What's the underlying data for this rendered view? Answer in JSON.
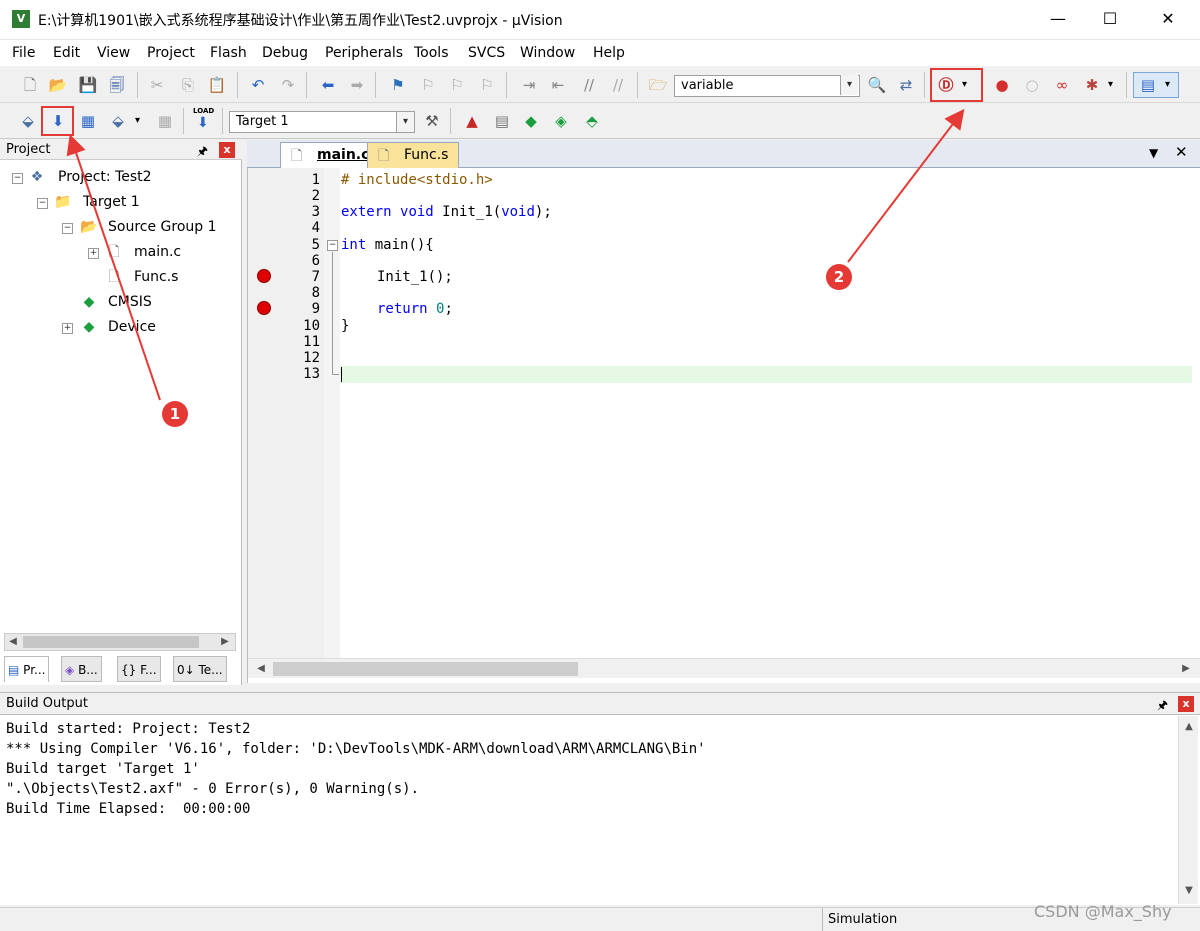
{
  "window": {
    "title": "E:\\计算机1901\\嵌入式系统程序基础设计\\作业\\第五周作业\\Test2.uvprojx - µVision",
    "minimize": "—",
    "maximize": "☐",
    "close": "✕"
  },
  "menu": [
    "File",
    "Edit",
    "View",
    "Project",
    "Flash",
    "Debug",
    "Peripherals",
    "Tools",
    "SVCS",
    "Window",
    "Help"
  ],
  "toolbar1": {
    "find_combo_value": "variable"
  },
  "toolbar2": {
    "target_combo_value": "Target 1",
    "load_label": "LOAD"
  },
  "project_panel": {
    "title": "Project",
    "pin": "🖈",
    "close": "x",
    "tree": {
      "project": "Project: Test2",
      "target": "Target 1",
      "group": "Source Group 1",
      "file1": "main.c",
      "file2": "Func.s",
      "cmsis": "CMSIS",
      "device": "Device"
    },
    "tabs": [
      "Pr...",
      "B...",
      "{} F...",
      "0↓ Te..."
    ]
  },
  "editor": {
    "tabs": [
      "main.c",
      "Func.s"
    ],
    "line_numbers": [
      "1",
      "2",
      "3",
      "4",
      "5",
      "6",
      "7",
      "8",
      "9",
      "10",
      "11",
      "12",
      "13"
    ],
    "breakpoint_lines": [
      7,
      9
    ],
    "code": {
      "l1": "# include<stdio.h>",
      "l3_kw1": "extern",
      "l3_kw2": "void",
      "l3_fn": "Init_1(",
      "l3_kw3": "void",
      "l3_end": ");",
      "l5_kw": "int",
      "l5_rest": "main(){",
      "l7": "Init_1();",
      "l9_kw": "return",
      "l9_num": "0",
      "l9_end": ";",
      "l10": "}"
    }
  },
  "build_output": {
    "title": "Build Output",
    "lines": [
      "Build started: Project: Test2",
      "*** Using Compiler 'V6.16', folder: 'D:\\DevTools\\MDK-ARM\\download\\ARM\\ARMCLANG\\Bin'",
      "Build target 'Target 1'",
      "\".\\Objects\\Test2.axf\" - 0 Error(s), 0 Warning(s).",
      "Build Time Elapsed:  00:00:00"
    ]
  },
  "statusbar": {
    "mode": "Simulation",
    "watermark": "CSDN @Max_Shy"
  },
  "annotations": {
    "a1": "1",
    "a2": "2",
    "color": "#e53935"
  }
}
